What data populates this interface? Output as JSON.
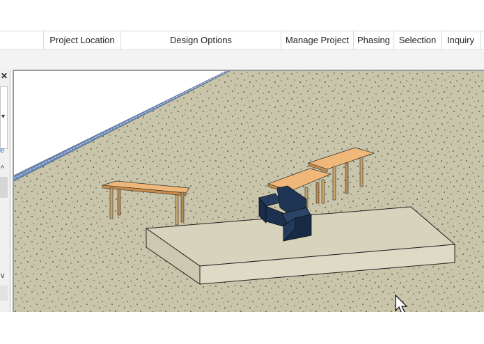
{
  "ribbon": {
    "panels": [
      {
        "label": "Project Location"
      },
      {
        "label": "Design Options"
      },
      {
        "label": "Manage Project"
      },
      {
        "label": "Phasing"
      },
      {
        "label": "Selection"
      },
      {
        "label": "Inquiry"
      }
    ]
  },
  "left_pane": {
    "close_glyph": "✕",
    "dropdown_glyph": "▾",
    "letter": "e",
    "scroll_up_glyph": "^",
    "scroll_down_glyph": "v"
  },
  "icons": {
    "close": "close-icon",
    "dropdown": "chevron-down-icon",
    "scroll_up": "chevron-up-icon",
    "scroll_down": "chevron-down-icon",
    "cursor": "mouse-pointer-icon"
  },
  "colors": {
    "floor": "#c8c4a8",
    "platform_top": "#d8d3bd",
    "table_top": "#f0b878",
    "sofa": "#1c3050",
    "wall": "#6d88b4"
  }
}
